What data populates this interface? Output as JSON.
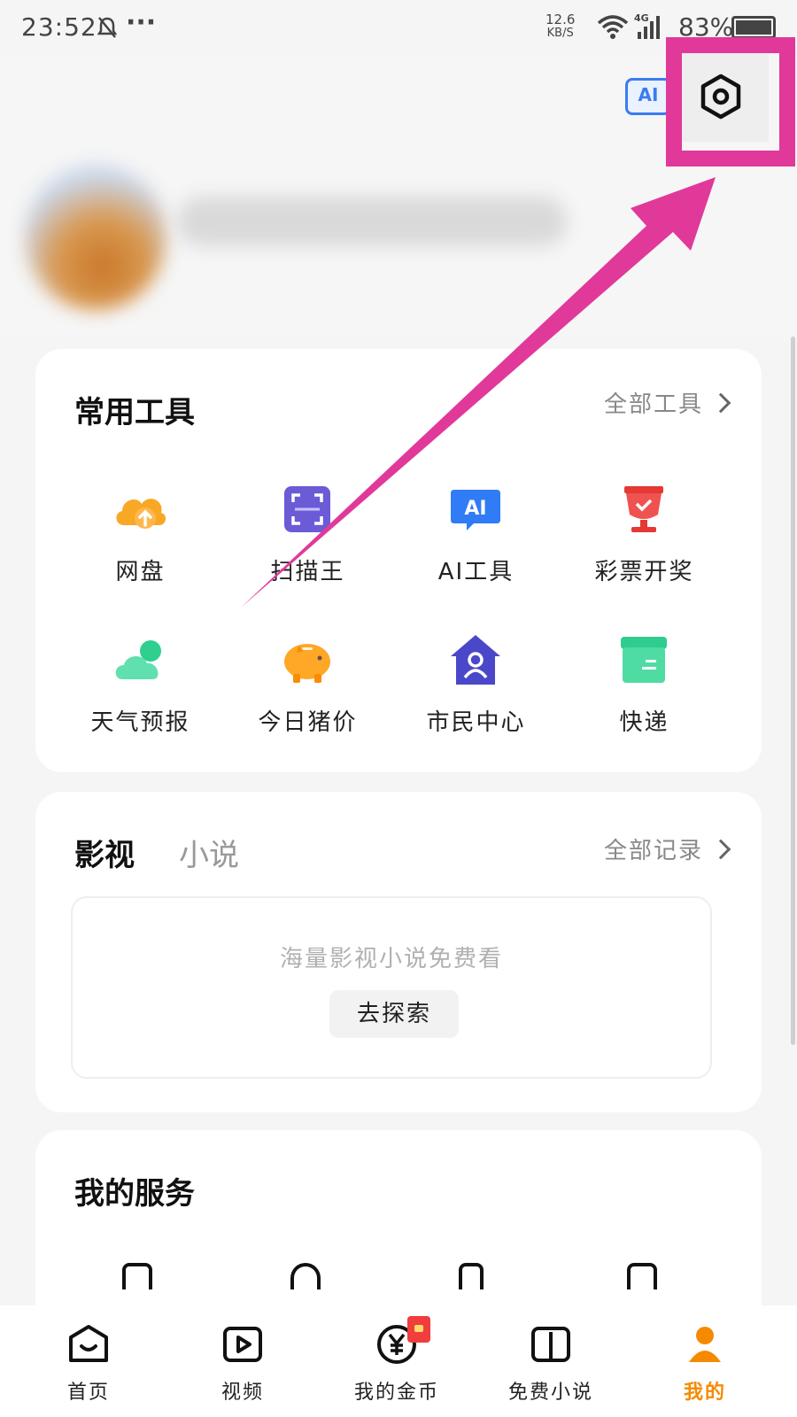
{
  "status_bar": {
    "time": "23:52",
    "dots": "···",
    "speed_value": "12.6",
    "speed_unit": "KB/S",
    "network": "4G",
    "battery": "83%"
  },
  "header": {
    "ai_badge": "AI",
    "settings_icon": "settings-hexagon-icon"
  },
  "tools": {
    "title": "常用工具",
    "link": "全部工具",
    "items": [
      {
        "label": "网盘",
        "icon": "cloud-upload-icon"
      },
      {
        "label": "扫描王",
        "icon": "scan-icon"
      },
      {
        "label": "AI工具",
        "icon": "ai-chat-icon"
      },
      {
        "label": "彩票开奖",
        "icon": "trophy-icon"
      },
      {
        "label": "天气预报",
        "icon": "weather-icon"
      },
      {
        "label": "今日猪价",
        "icon": "piggy-icon"
      },
      {
        "label": "市民中心",
        "icon": "citizen-home-icon"
      },
      {
        "label": "快递",
        "icon": "delivery-box-icon"
      }
    ]
  },
  "media": {
    "tab_active": "影视",
    "tab_inactive": "小说",
    "link": "全部记录",
    "empty_text": "海量影视小说免费看",
    "explore_button": "去探索"
  },
  "services": {
    "title": "我的服务"
  },
  "bottom_nav": [
    {
      "label": "首页",
      "icon": "home-icon"
    },
    {
      "label": "视频",
      "icon": "play-icon"
    },
    {
      "label": "我的金币",
      "icon": "coin-icon"
    },
    {
      "label": "免费小说",
      "icon": "book-icon"
    },
    {
      "label": "我的",
      "icon": "profile-icon",
      "active": true
    }
  ],
  "colors": {
    "highlight": "#e0399a",
    "accent_orange": "#f58a00",
    "ai_blue": "#3a7cf0"
  }
}
